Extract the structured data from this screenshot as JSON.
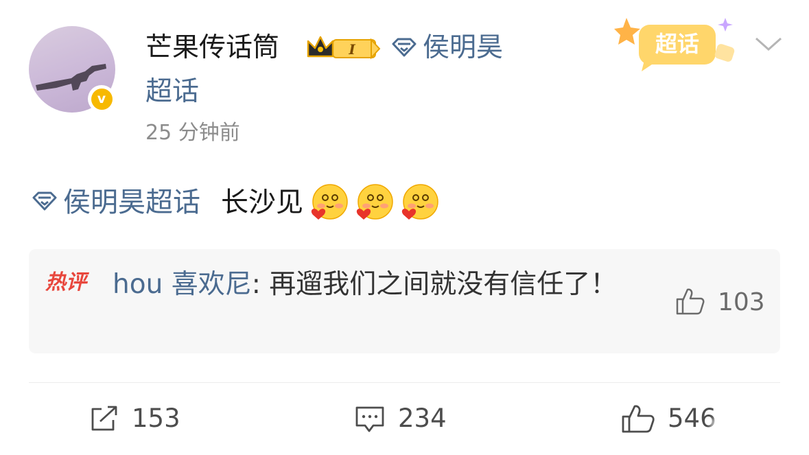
{
  "post": {
    "username": "芒果传话筒",
    "level_badge": "I",
    "topic_line1": "侯明昊",
    "topic_line2": "超话",
    "time": "25 分钟前",
    "badge_text": "超话",
    "topic_tag": "侯明昊超话",
    "text": "长沙见",
    "emojis": [
      "heart-emoji",
      "heart-emoji",
      "heart-emoji"
    ]
  },
  "hot_comment": {
    "label": "热评",
    "author": "hou 喜欢尼",
    "text": ": 再遛我们之间就没有信任了！",
    "likes": "103"
  },
  "actions": {
    "repost_count": "153",
    "comment_count": "234",
    "like_count": "546"
  },
  "colors": {
    "topic_blue": "#4b6b90",
    "verified_gold": "#f7b900",
    "hot_red": "#e8473d"
  }
}
